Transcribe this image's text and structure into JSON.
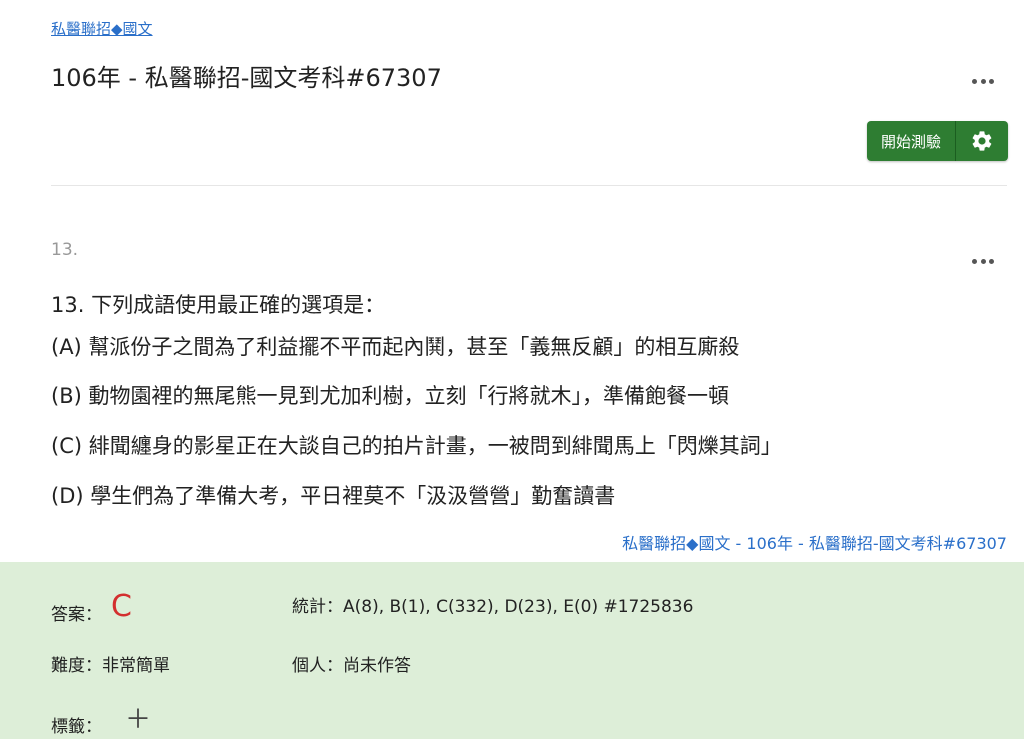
{
  "breadcrumb": "私醫聯招◆國文",
  "title": "106年 - 私醫聯招-國文考科#67307",
  "start_button": "開始測驗",
  "question_number": "13.",
  "question": {
    "text": "13. 下列成語使用最正確的選項是：",
    "options": [
      "(A) 幫派份子之間為了利益擺不平而起內鬨，甚至「義無反顧」的相互廝殺",
      "(B) 動物園裡的無尾熊一見到尤加利樹，立刻「行將就木」，準備飽餐一頓",
      "(C) 緋聞纏身的影星正在大談自己的拍片計畫，一被問到緋聞馬上「閃爍其詞」",
      "(D) 學生們為了準備大考，平日裡莫不「汲汲營營」勤奮讀書"
    ]
  },
  "source": {
    "category": "私醫聯招◆國文",
    "separator": " - ",
    "exam": "106年 - 私醫聯招-國文考科#67307"
  },
  "answer_panel": {
    "answer_label": "答案：",
    "answer_value": "C",
    "stats": "統計：A(8), B(1), C(332), D(23), E(0) #1725836",
    "difficulty": "難度：非常簡單",
    "personal": "個人：尚未作答",
    "tags_label": "標籤：",
    "plus": "＋"
  },
  "colors": {
    "link": "#2a6fc9",
    "button": "#2e7d32",
    "panel_bg": "#ddeed8",
    "answer": "#d32f2f"
  }
}
